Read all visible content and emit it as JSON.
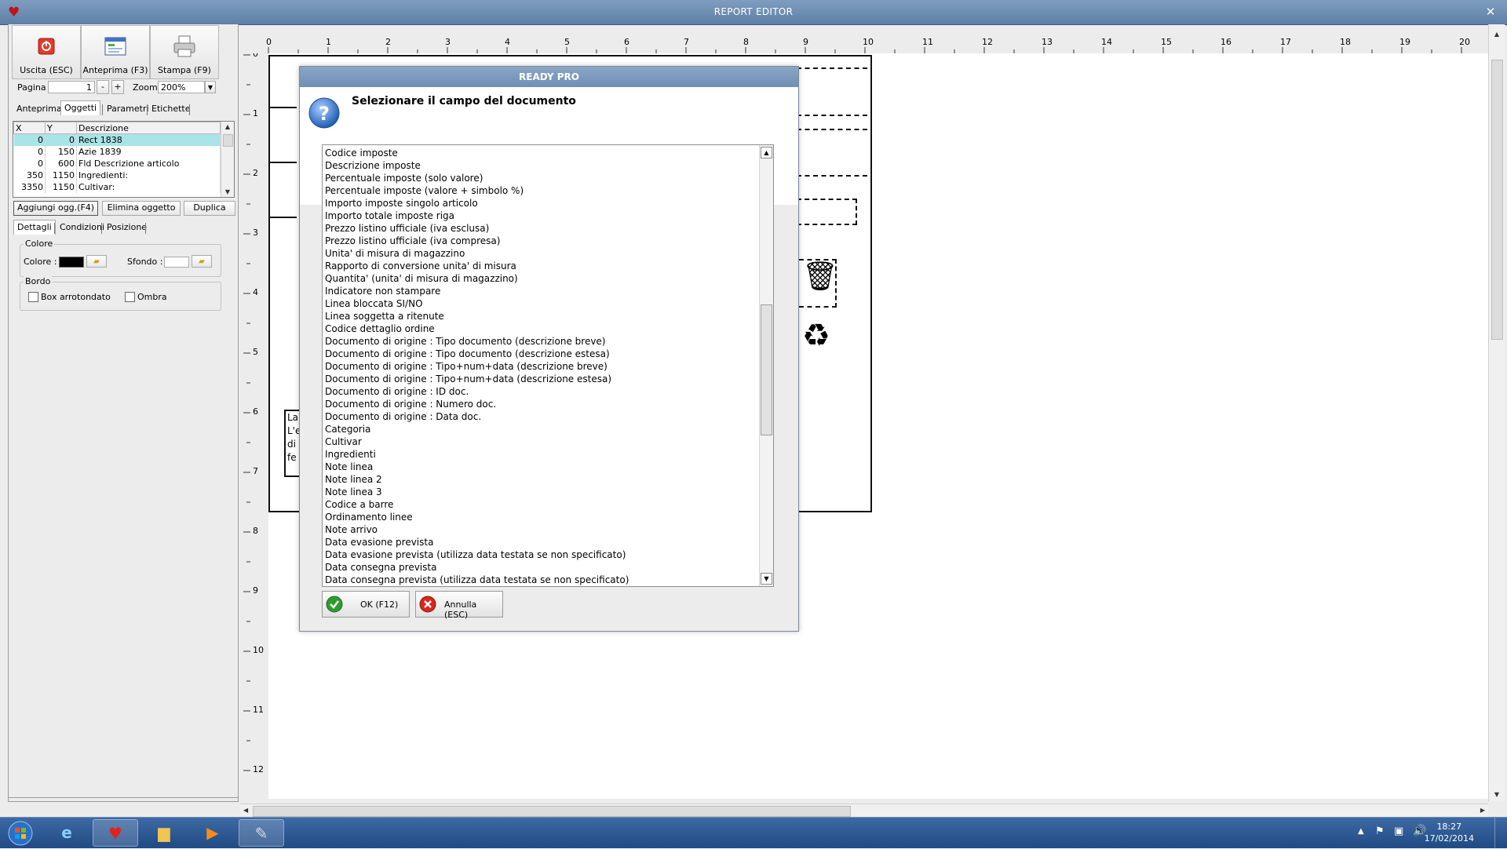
{
  "window": {
    "title": "REPORT EDITOR",
    "close_glyph": "✕"
  },
  "toolbar": {
    "exit_label": "Uscita (ESC)",
    "preview_label": "Anteprima (F3)",
    "print_label": "Stampa (F9)",
    "page_label": "Pagina",
    "page_value": "1",
    "page_minus": "-",
    "page_plus": "+",
    "zoom_label": "Zoom",
    "zoom_value": "200%"
  },
  "tabs_top": [
    "Anteprima",
    "Oggetti",
    "Parametri",
    "Etichette"
  ],
  "objects_table": {
    "columns": [
      "X",
      "Y",
      "Descrizione"
    ],
    "rows": [
      {
        "x": "0",
        "y": "0",
        "desc": "Rect 1838"
      },
      {
        "x": "0",
        "y": "150",
        "desc": "Azie 1839"
      },
      {
        "x": "0",
        "y": "600",
        "desc": "Fld Descrizione articolo"
      },
      {
        "x": "350",
        "y": "1150",
        "desc": "Ingredienti:"
      },
      {
        "x": "3350",
        "y": "1150",
        "desc": "Cultivar:"
      }
    ]
  },
  "object_buttons": {
    "add": "Aggiungi ogg.(F4)",
    "delete": "Elimina oggetto",
    "duplicate": "Duplica"
  },
  "tabs_detail": [
    "Dettagli",
    "Condizioni",
    "Posizione"
  ],
  "color_group": {
    "title": "Colore",
    "color_label": "Colore :",
    "background_label": "Sfondo :",
    "color_value": "#000000",
    "background_value": "#ffffff"
  },
  "border_group": {
    "title": "Bordo",
    "rounded_label": "Box arrotondato",
    "shadow_label": "Ombra"
  },
  "ruler": {
    "top_marks": [
      "0",
      "1",
      "2",
      "3",
      "4",
      "5",
      "6",
      "7",
      "8",
      "9",
      "10",
      "11",
      "12",
      "13",
      "14",
      "15",
      "16",
      "17",
      "18",
      "19",
      "20"
    ],
    "left_marks": [
      "0",
      "1",
      "2",
      "3",
      "4",
      "5",
      "6",
      "7",
      "8",
      "9",
      "10",
      "11",
      "12"
    ]
  },
  "canvas": {
    "label_fragment": [
      "La",
      "L'e",
      "di",
      "fe"
    ]
  },
  "dialog": {
    "title": "READY PRO",
    "heading": "Selezionare il campo del documento",
    "fields": [
      "Codice imposte",
      "Descrizione imposte",
      "Percentuale imposte (solo valore)",
      "Percentuale imposte (valore + simbolo %)",
      "Importo imposte singolo articolo",
      "Importo totale imposte riga",
      "Prezzo listino ufficiale (iva esclusa)",
      "Prezzo listino ufficiale (iva compresa)",
      "Unita' di misura di magazzino",
      "Rapporto di conversione unita' di misura",
      "Quantita' (unita' di misura di magazzino)",
      "Indicatore non stampare",
      "Linea bloccata SI/NO",
      "Linea soggetta a ritenute",
      "Codice dettaglio ordine",
      "Documento di origine : Tipo documento (descrizione breve)",
      "Documento di origine : Tipo documento (descrizione estesa)",
      "Documento di origine : Tipo+num+data (descrizione breve)",
      "Documento di origine : Tipo+num+data (descrizione estesa)",
      "Documento di origine : ID doc.",
      "Documento di origine : Numero doc.",
      "Documento di origine : Data doc.",
      "Categoria",
      "Cultivar",
      "Ingredienti",
      "Note linea",
      "Note linea 2",
      "Note linea 3",
      "Codice a barre",
      "Ordinamento linee",
      "Note arrivo",
      "Data evasione prevista",
      "Data evasione prevista (utilizza data testata se non specificato)",
      "Data consegna prevista",
      "Data consegna prevista (utilizza data testata se non specificato)"
    ],
    "ok_label": "OK (F12)",
    "cancel_label": "Annulla (ESC)"
  },
  "taskbar": {
    "time": "18:27",
    "date": "17/02/2014"
  },
  "colors": {
    "titlebar": "#6f8fb5",
    "selection": "#a8e4e8",
    "taskbar": "#2a5590"
  }
}
